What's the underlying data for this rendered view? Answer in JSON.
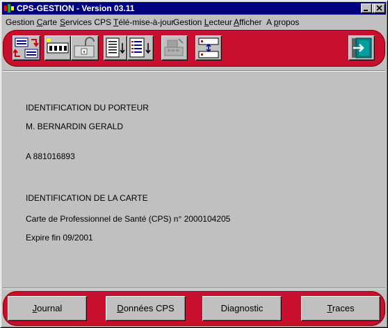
{
  "window": {
    "title": "CPS-GESTION - Version 03.11"
  },
  "menu": {
    "items": [
      {
        "pre": "Gestion ",
        "ul": "C",
        "post": "arte"
      },
      {
        "pre": "",
        "ul": "S",
        "post": "ervices CPS"
      },
      {
        "pre": "",
        "ul": "T",
        "post": "élé-mise-à-jour"
      },
      {
        "pre": "Gestion ",
        "ul": "L",
        "post": "ecteur"
      },
      {
        "pre": "",
        "ul": "A",
        "post": "fficher"
      },
      {
        "pre": "A ",
        "ul": "p",
        "post": "ropos"
      }
    ]
  },
  "toolbar": {
    "icons": [
      "card-transfer-icon",
      "card-reader-icon",
      "unlock-card-icon",
      "document-download-icon",
      "document-list-download-icon",
      "reader-device-icon",
      "sync-icon",
      "exit-door-icon"
    ]
  },
  "content": {
    "holder_heading": "IDENTIFICATION DU PORTEUR",
    "holder_name": "M. BERNARDIN GERALD",
    "holder_id": "A 881016893",
    "card_heading": "IDENTIFICATION DE LA CARTE",
    "card_desc": "Carte de Professionnel de Santé (CPS) n° 2000104205",
    "card_expiry": "Expire fin 09/2001"
  },
  "buttons": {
    "journal": {
      "ul": "J",
      "rest": "ournal"
    },
    "donnees": {
      "ul": "D",
      "rest": "onnées CPS"
    },
    "diagnostic": {
      "pre": "Dia",
      "ul": "g",
      "rest": "nostic"
    },
    "traces": {
      "ul": "T",
      "rest": "races"
    }
  },
  "colors": {
    "titlebar": "#000080",
    "accent": "#c8102e",
    "face": "#c0c0c0"
  }
}
